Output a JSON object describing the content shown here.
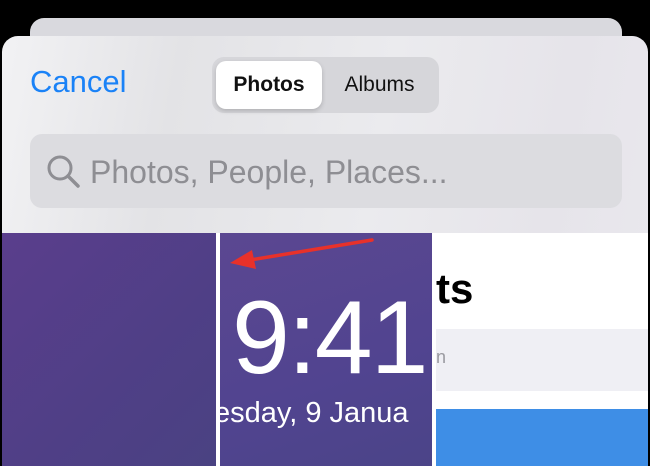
{
  "header": {
    "cancel_label": "Cancel",
    "tabs": [
      {
        "label": "Photos",
        "selected": true
      },
      {
        "label": "Albums",
        "selected": false
      }
    ]
  },
  "search": {
    "placeholder": "Photos, People, Places..."
  },
  "grid": {
    "thumb2": {
      "time": "9:41",
      "date": "esday, 9 Janua"
    },
    "thumb3": {
      "heading": "ts",
      "label": "n"
    }
  },
  "colors": {
    "accent": "#1a82f7",
    "arrow": "#e8312a",
    "thumb_purple": "#574291",
    "blue_bar": "#3e8ee6"
  },
  "icons": [
    "search-icon",
    "arrow-icon"
  ]
}
